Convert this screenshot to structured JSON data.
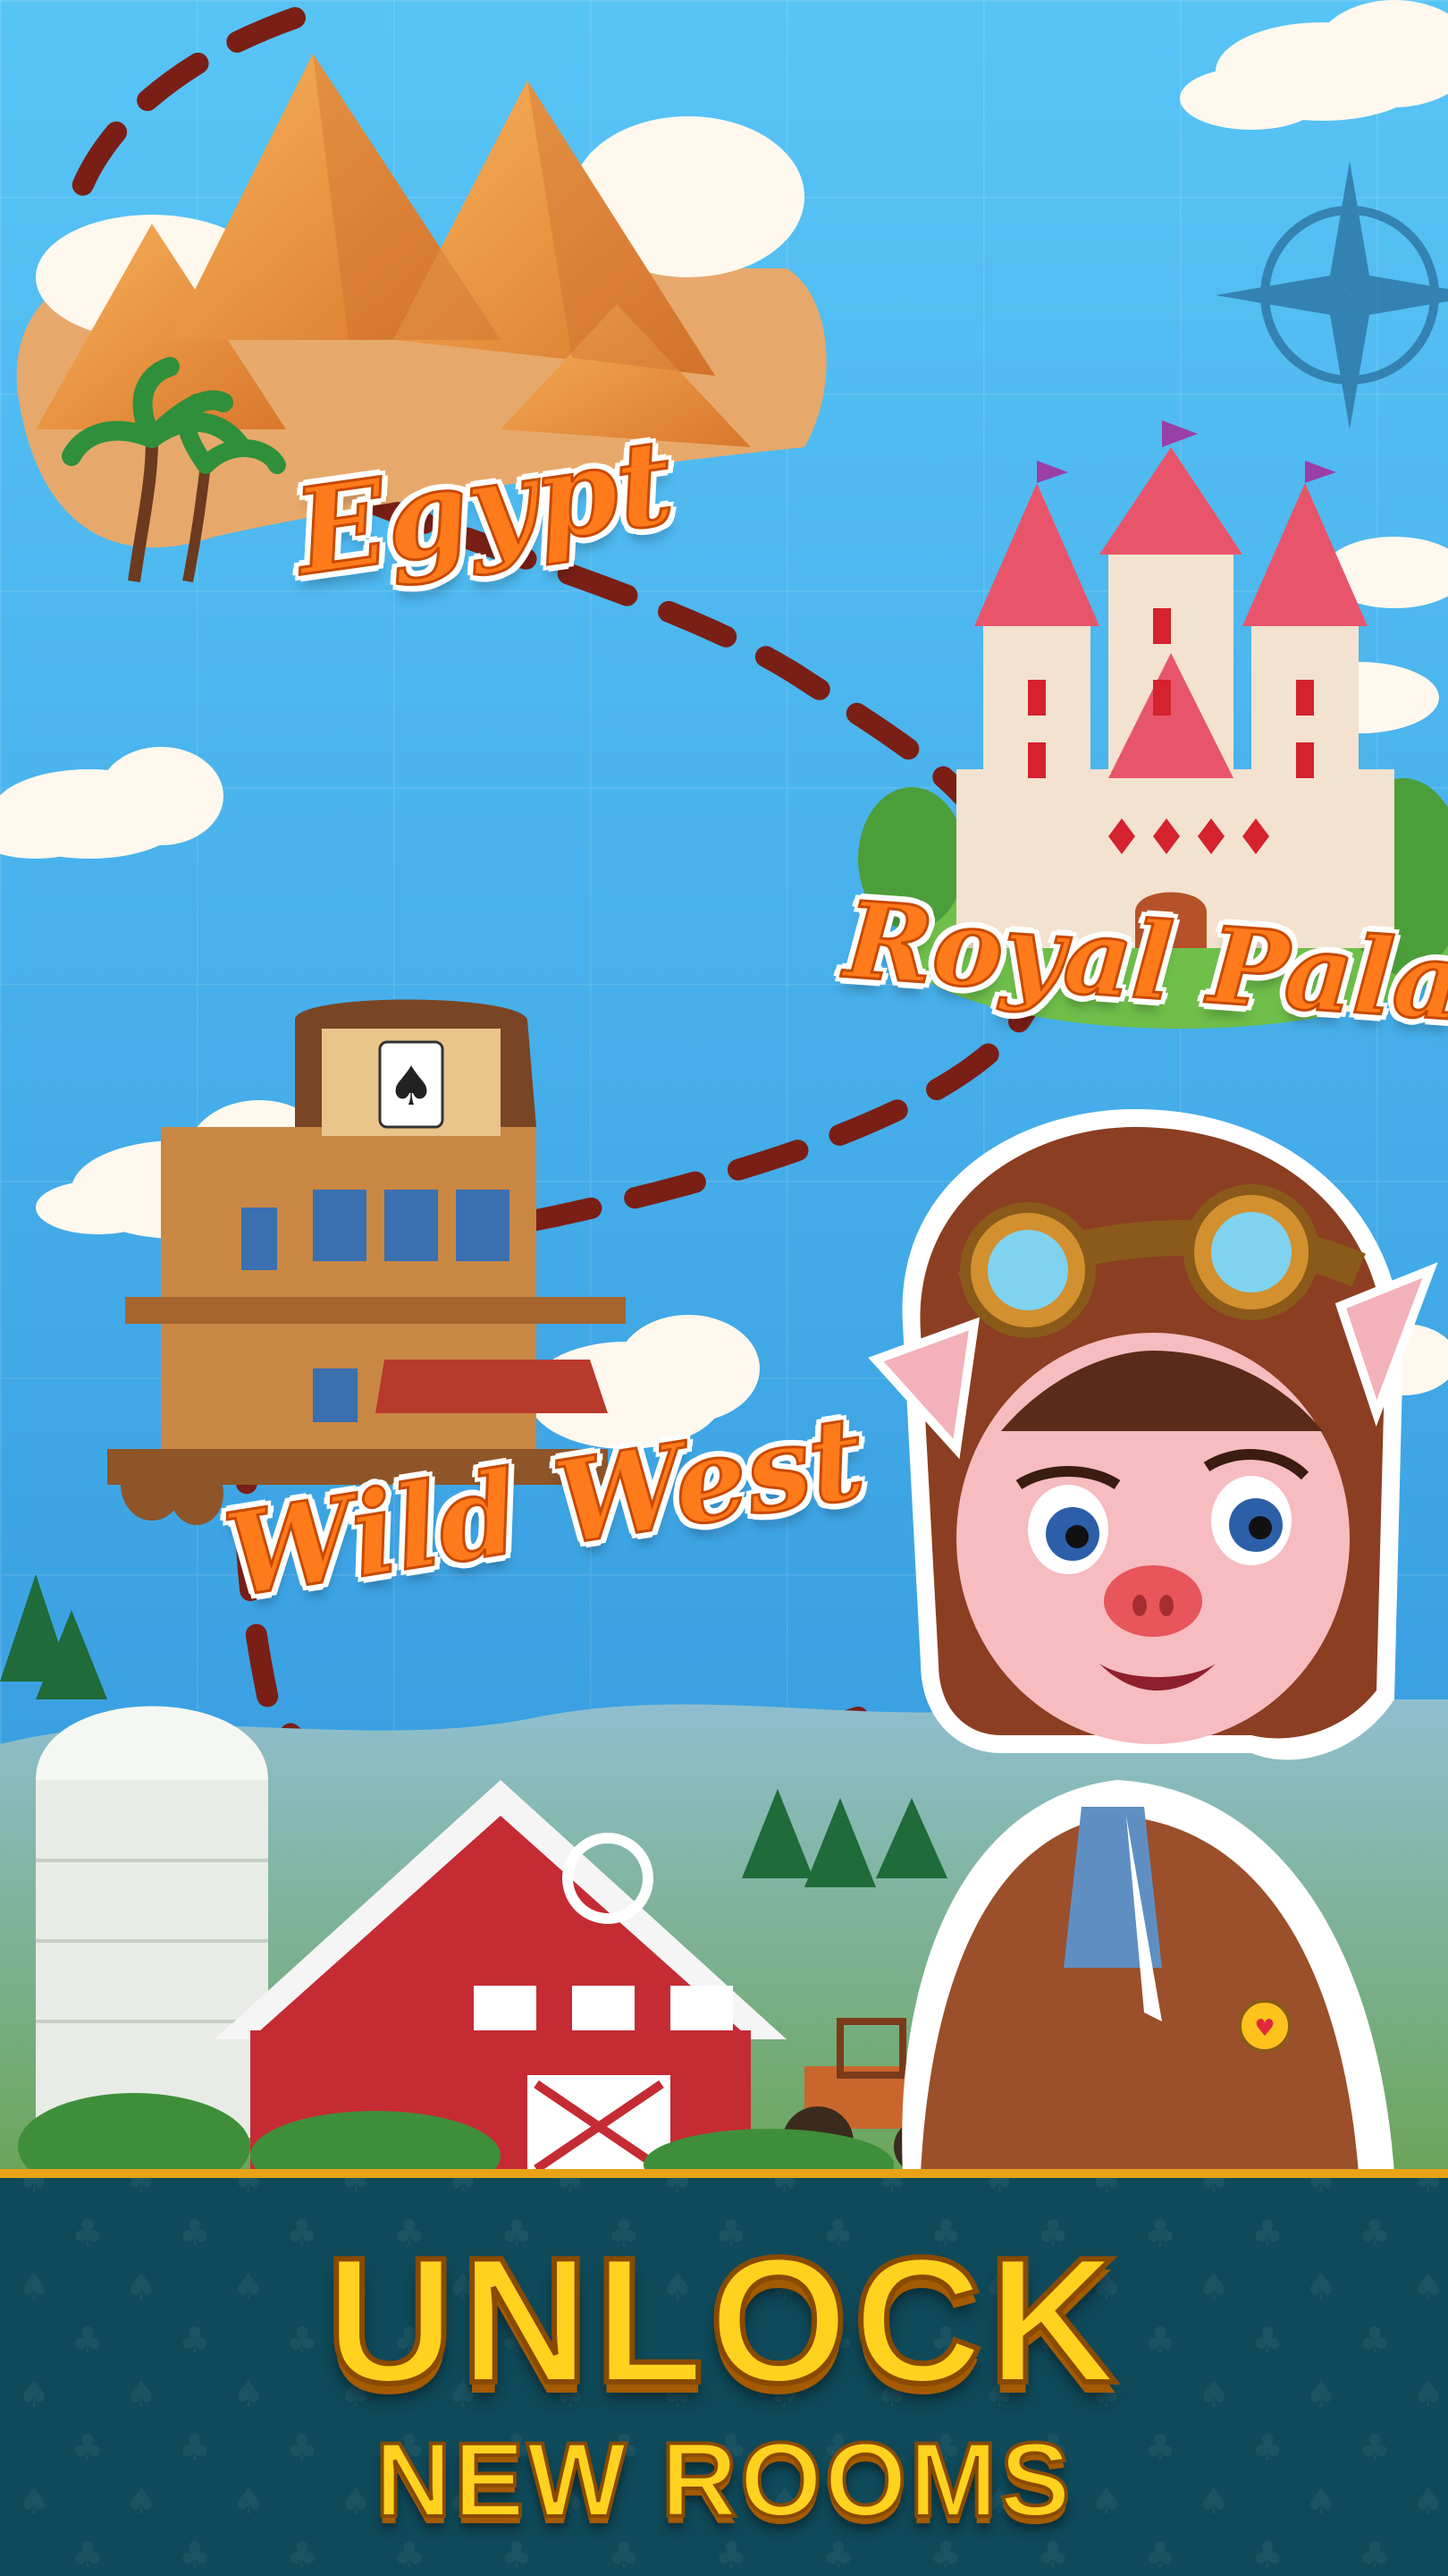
{
  "locations": {
    "egypt": "Egypt",
    "royal_palace": "Royal Palace",
    "wild_west": "Wild West"
  },
  "banner": {
    "title": "UNLOCK",
    "subtitle": "NEW ROOMS"
  },
  "colors": {
    "sky": "#3fa9e8",
    "path": "#7a1f16",
    "label": "#ff7a1a",
    "banner_bg": "#0f4a5a",
    "banner_text": "#ffd21f"
  },
  "icons": [
    "compass-icon",
    "playing-card-spade-icon",
    "heart-badge-icon"
  ]
}
